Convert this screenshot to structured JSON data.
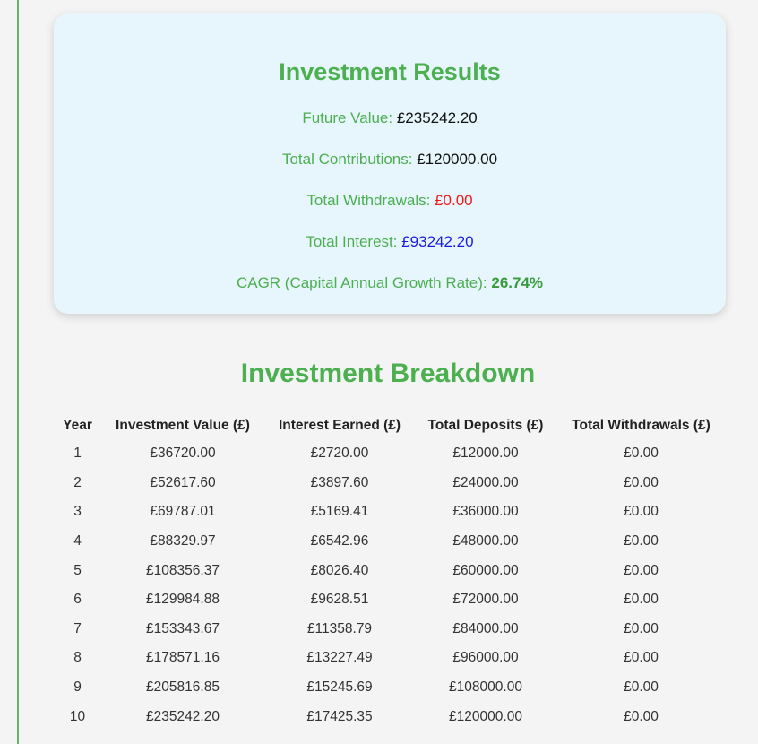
{
  "results": {
    "title": "Investment Results",
    "rows": [
      {
        "label": "Future Value: ",
        "value": "£235242.20",
        "value_color": "#111111"
      },
      {
        "label": "Total Contributions: ",
        "value": "£120000.00",
        "value_color": "#111111"
      },
      {
        "label": "Total Withdrawals: ",
        "value": "£0.00",
        "value_color": "#f01c1c"
      },
      {
        "label": "Total Interest: ",
        "value": "£93242.20",
        "value_color": "#1a1ae6"
      },
      {
        "label": "CAGR (Capital Annual Growth Rate): ",
        "value": "26.74%",
        "value_color": "#3a9a3e"
      }
    ]
  },
  "breakdown": {
    "title": "Investment Breakdown",
    "columns": [
      "Year",
      "Investment Value (£)",
      "Interest Earned (£)",
      "Total Deposits (£)",
      "Total Withdrawals (£)"
    ],
    "rows": [
      [
        "1",
        "£36720.00",
        "£2720.00",
        "£12000.00",
        "£0.00"
      ],
      [
        "2",
        "£52617.60",
        "£3897.60",
        "£24000.00",
        "£0.00"
      ],
      [
        "3",
        "£69787.01",
        "£5169.41",
        "£36000.00",
        "£0.00"
      ],
      [
        "4",
        "£88329.97",
        "£6542.96",
        "£48000.00",
        "£0.00"
      ],
      [
        "5",
        "£108356.37",
        "£8026.40",
        "£60000.00",
        "£0.00"
      ],
      [
        "6",
        "£129984.88",
        "£9628.51",
        "£72000.00",
        "£0.00"
      ],
      [
        "7",
        "£153343.67",
        "£11358.79",
        "£84000.00",
        "£0.00"
      ],
      [
        "8",
        "£178571.16",
        "£13227.49",
        "£96000.00",
        "£0.00"
      ],
      [
        "9",
        "£205816.85",
        "£15245.69",
        "£108000.00",
        "£0.00"
      ],
      [
        "10",
        "£235242.20",
        "£17425.35",
        "£120000.00",
        "£0.00"
      ]
    ]
  },
  "colors": {
    "accent_green": "#4caf50",
    "card_background": "#e6f6fc",
    "page_background": "#f4f4f4"
  }
}
